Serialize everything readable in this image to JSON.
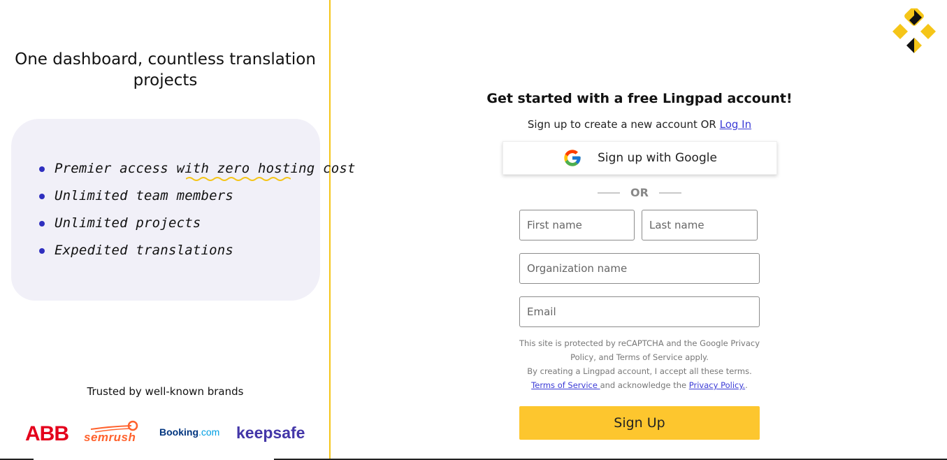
{
  "left": {
    "title": "One dashboard, countless translation projects",
    "features": [
      "Premier access with zero hosting cost",
      "Unlimited team members",
      "Unlimited projects",
      "Expedited translations"
    ],
    "trusted_label": "Trusted by well-known brands",
    "brands": {
      "abb": "ABB",
      "semrush": "semrush",
      "booking_main": "Booking",
      "booking_tld": ".com",
      "keepsafe": "keepsafe"
    }
  },
  "signup": {
    "heading": "Get started with a free Lingpad account!",
    "subtitle_prefix": "Sign up to create a new account OR ",
    "login_link": "Log In",
    "google_button": "Sign up with Google",
    "or_text": "OR",
    "first_name_placeholder": "First name",
    "last_name_placeholder": "Last name",
    "organization_placeholder": "Organization name",
    "email_placeholder": "Email",
    "legal_line1": "This site is protected by reCAPTCHA and the Google Privacy Policy, and Terms of Service apply.",
    "legal_line2": "By creating a Lingpad account, I accept all these terms.",
    "terms_link": "Terms of Service ",
    "legal_middle": "and acknowledge the ",
    "privacy_link": "Privacy Policy.",
    "legal_end": ".",
    "submit_button": "Sign Up"
  },
  "colors": {
    "accent_yellow": "#fdc62e",
    "link_blue": "#3b3bd6",
    "card_bg": "#f1f0f8"
  },
  "icons": [
    "lingpad-logo-icon",
    "google-g-icon"
  ]
}
